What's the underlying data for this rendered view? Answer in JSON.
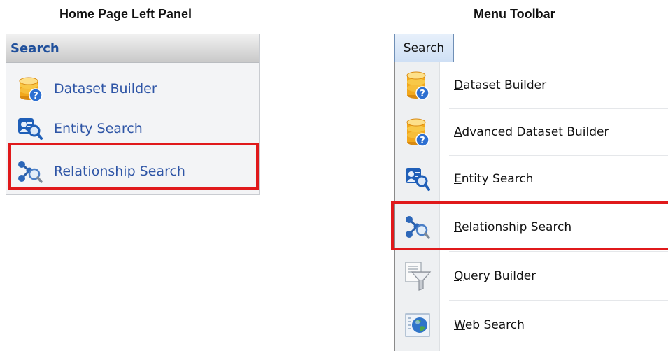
{
  "captions": {
    "left": "Home Page Left Panel",
    "right": "Menu Toolbar"
  },
  "left_panel": {
    "header": "Search",
    "items": [
      {
        "label": "Dataset Builder",
        "icon": "database-help-icon"
      },
      {
        "label": "Entity Search",
        "icon": "entity-search-icon"
      },
      {
        "label": "Relationship Search",
        "icon": "relationship-search-icon"
      }
    ],
    "highlighted_item": "Relationship Search"
  },
  "menu": {
    "tab": "Search",
    "items": [
      {
        "accel": "D",
        "rest": "ataset Builder",
        "icon": "database-help-icon"
      },
      {
        "accel": "A",
        "rest": "dvanced Dataset Builder",
        "icon": "database-help-icon"
      },
      {
        "accel": "E",
        "rest": "ntity Search",
        "icon": "entity-search-icon"
      },
      {
        "accel": "R",
        "rest": "elationship Search",
        "icon": "relationship-search-icon"
      },
      {
        "accel": "Q",
        "rest": "uery Builder",
        "icon": "query-funnel-icon"
      },
      {
        "accel": "W",
        "rest": "eb Search",
        "icon": "web-globe-icon"
      }
    ],
    "highlighted_item": "Relationship Search"
  },
  "colors": {
    "highlight": "#e0191b",
    "link_blue": "#2e55a6",
    "header_blue": "#1f4f9b"
  }
}
